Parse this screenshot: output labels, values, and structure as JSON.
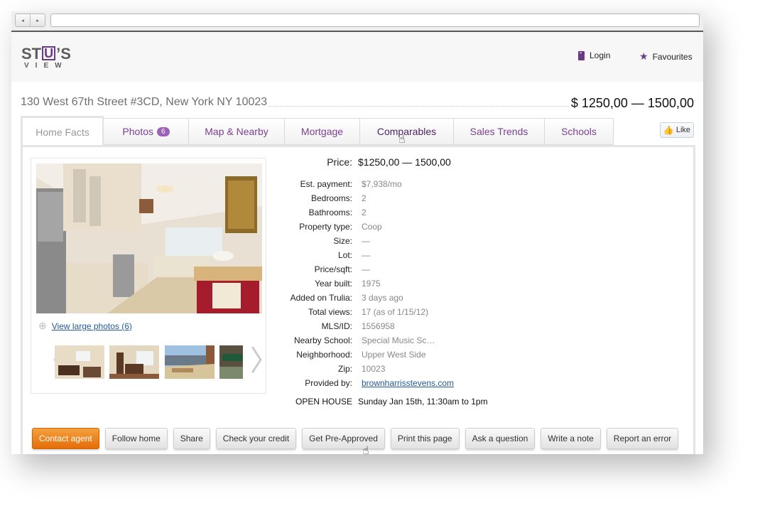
{
  "browser": {
    "back_icon": "◂",
    "forward_icon": "▸",
    "url": ""
  },
  "header": {
    "logo_top_left": "ST",
    "logo_u": "U",
    "logo_top_right": "’S",
    "logo_bottom": "VIEW",
    "login_label": "Login",
    "favourites_label": "Favourites",
    "favourites_icon": "★"
  },
  "listing": {
    "address": "130 West 67th Street #3CD, New York NY 10023",
    "price_range": "$ 1250,00 — 1500,00"
  },
  "tabs": [
    {
      "label": "Home Facts",
      "active": true
    },
    {
      "label": "Photos",
      "badge": "6"
    },
    {
      "label": "Map & Nearby"
    },
    {
      "label": "Mortgage"
    },
    {
      "label": "Comparables"
    },
    {
      "label": "Sales Trends"
    },
    {
      "label": "Schools"
    }
  ],
  "like": {
    "label": "Like",
    "icon": "👍"
  },
  "photos": {
    "view_large_label": "View large photos (6)",
    "magnifier_icon": "⊕",
    "prev_icon": "〈",
    "next_icon": "〉"
  },
  "facts": {
    "price": {
      "label": "Price:",
      "value": "$1250,00 — 1500,00"
    },
    "rows": [
      {
        "label": "Est. payment:",
        "value": "$7,938/mo"
      },
      {
        "label": "Bedrooms:",
        "value": "2"
      },
      {
        "label": "Bathrooms:",
        "value": "2"
      },
      {
        "label": "Property type:",
        "value": "Coop"
      },
      {
        "label": "Size:",
        "value": "—"
      },
      {
        "label": "Lot:",
        "value": "—"
      },
      {
        "label": "Price/sqft:",
        "value": "—"
      },
      {
        "label": "Year built:",
        "value": "1975"
      },
      {
        "label": "Added on Trulia:",
        "value": "3 days ago"
      },
      {
        "label": "Total views:",
        "value": "17 (as of 1/15/12)"
      },
      {
        "label": "MLS/ID:",
        "value": "1556958"
      },
      {
        "label": "Nearby School:",
        "value": "Special Music Sc…"
      },
      {
        "label": "Neighborhood:",
        "value": "Upper West Side"
      },
      {
        "label": "Zip:",
        "value": "10023"
      }
    ],
    "provided_by": {
      "label": "Provided by:",
      "value": "brownharrisstevens.com"
    },
    "open_house": {
      "label": "OPEN HOUSE",
      "value": "Sunday Jan 15th, 11:30am to 1pm"
    }
  },
  "actions": [
    "Contact agent",
    "Follow home",
    "Share",
    "Check your credit",
    "Get Pre-Approved",
    "Print this page",
    "Ask a question",
    "Write a note",
    "Report an error"
  ],
  "colors": {
    "brand_purple": "#7b3f93",
    "badge_purple": "#9b63b8",
    "primary_orange": "#e46d08",
    "link_blue": "#1f5a9c"
  }
}
